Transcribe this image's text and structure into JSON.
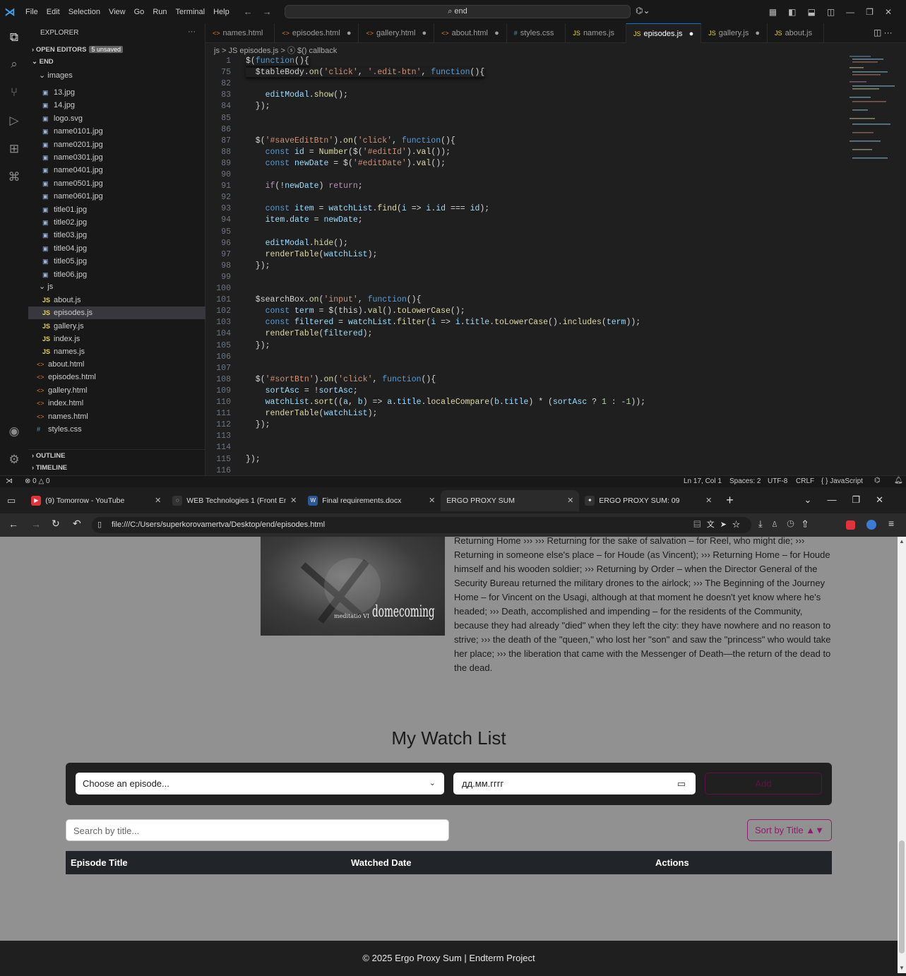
{
  "vscode": {
    "menu": [
      "File",
      "Edit",
      "Selection",
      "View",
      "Go",
      "Run",
      "Terminal",
      "Help"
    ],
    "command_center": "end",
    "explorer": {
      "title": "EXPLORER",
      "open_editors": "OPEN EDITORS",
      "unsaved": "5 unsaved",
      "root": "END",
      "images_folder": "images",
      "images": [
        "13.jpg",
        "14.jpg",
        "logo.svg",
        "name0101.jpg",
        "name0201.jpg",
        "name0301.jpg",
        "name0401.jpg",
        "name0501.jpg",
        "name0601.jpg",
        "title01.jpg",
        "title02.jpg",
        "title03.jpg",
        "title04.jpg",
        "title05.jpg",
        "title06.jpg"
      ],
      "js_folder": "js",
      "js_files": [
        "about.js",
        "episodes.js",
        "gallery.js",
        "index.js",
        "names.js"
      ],
      "root_files": [
        "about.html",
        "episodes.html",
        "gallery.html",
        "index.html",
        "names.html",
        "styles.css"
      ],
      "outline": "OUTLINE",
      "timeline": "TIMELINE"
    },
    "tabs": [
      {
        "label": "names.html",
        "type": "html",
        "dirty": false
      },
      {
        "label": "episodes.html",
        "type": "html",
        "dirty": true
      },
      {
        "label": "gallery.html",
        "type": "html",
        "dirty": true
      },
      {
        "label": "about.html",
        "type": "html",
        "dirty": true
      },
      {
        "label": "styles.css",
        "type": "css",
        "dirty": false
      },
      {
        "label": "names.js",
        "type": "js",
        "dirty": false
      },
      {
        "label": "episodes.js",
        "type": "js",
        "dirty": true,
        "active": true
      },
      {
        "label": "gallery.js",
        "type": "js",
        "dirty": true
      },
      {
        "label": "about.js",
        "type": "js",
        "dirty": false
      }
    ],
    "breadcrumb": "js > JS episodes.js > ⓢ $() callback",
    "code": [
      {
        "ln": "1",
        "code": "$(function(){"
      },
      {
        "ln": "75",
        "code": "  $tableBody.on('click', '.edit-btn', function(){"
      },
      {
        "ln": "82",
        "code": ""
      },
      {
        "ln": "83",
        "code": "    editModal.show();"
      },
      {
        "ln": "84",
        "code": "  });"
      },
      {
        "ln": "85",
        "code": ""
      },
      {
        "ln": "86",
        "code": ""
      },
      {
        "ln": "87",
        "code": "  $('#saveEditBtn').on('click', function(){"
      },
      {
        "ln": "88",
        "code": "    const id = Number($('#editId').val());"
      },
      {
        "ln": "89",
        "code": "    const newDate = $('#editDate').val();"
      },
      {
        "ln": "90",
        "code": ""
      },
      {
        "ln": "91",
        "code": "    if(!newDate) return;"
      },
      {
        "ln": "92",
        "code": ""
      },
      {
        "ln": "93",
        "code": "    const item = watchList.find(i => i.id === id);"
      },
      {
        "ln": "94",
        "code": "    item.date = newDate;"
      },
      {
        "ln": "95",
        "code": ""
      },
      {
        "ln": "96",
        "code": "    editModal.hide();"
      },
      {
        "ln": "97",
        "code": "    renderTable(watchList);"
      },
      {
        "ln": "98",
        "code": "  });"
      },
      {
        "ln": "99",
        "code": ""
      },
      {
        "ln": "100",
        "code": ""
      },
      {
        "ln": "101",
        "code": "  $searchBox.on('input', function(){"
      },
      {
        "ln": "102",
        "code": "    const term = $(this).val().toLowerCase();"
      },
      {
        "ln": "103",
        "code": "    const filtered = watchList.filter(i => i.title.toLowerCase().includes(term));"
      },
      {
        "ln": "104",
        "code": "    renderTable(filtered);"
      },
      {
        "ln": "105",
        "code": "  });"
      },
      {
        "ln": "106",
        "code": ""
      },
      {
        "ln": "107",
        "code": ""
      },
      {
        "ln": "108",
        "code": "  $('#sortBtn').on('click', function(){"
      },
      {
        "ln": "109",
        "code": "    sortAsc = !sortAsc;"
      },
      {
        "ln": "110",
        "code": "    watchList.sort((a, b) => a.title.localeCompare(b.title) * (sortAsc ? 1 : -1));"
      },
      {
        "ln": "111",
        "code": "    renderTable(watchList);"
      },
      {
        "ln": "112",
        "code": "  });"
      },
      {
        "ln": "113",
        "code": ""
      },
      {
        "ln": "114",
        "code": ""
      },
      {
        "ln": "115",
        "code": "});"
      },
      {
        "ln": "116",
        "code": ""
      }
    ],
    "status": {
      "problems": "⊗ 0 △ 0",
      "position": "Ln 17, Col 1",
      "spaces": "Spaces: 2",
      "encoding": "UTF-8",
      "eol": "CRLF",
      "language": "{ } JavaScript"
    }
  },
  "browser": {
    "tabs": [
      {
        "label": "(9) Tomorrow - YouTube",
        "fav": "yt"
      },
      {
        "label": "WEB Technologies 1 (Front End) |",
        "fav": "web"
      },
      {
        "label": "Final requirements.docx",
        "fav": "word"
      },
      {
        "label": "ERGO PROXY SUM",
        "fav": "none",
        "active": true
      },
      {
        "label": "ERGO PROXY SUM: 09",
        "fav": "ep"
      }
    ],
    "url": "file:///C:/Users/superkorovamertva/Desktop/end/episodes.html"
  },
  "page": {
    "poster_caption": "meditatio VI",
    "poster_word": "domecoming",
    "description": "Returning Home ››› ››› Returning for the sake of salvation – for Reel, who might die; ››› Returning in someone else's place – for Houde (as Vincent); ››› Returning Home – for Houde himself and his wooden soldier; ››› Returning by Order – when the Director General of the Security Bureau returned the military drones to the airlock; ››› The Beginning of the Journey Home – for Vincent on the Usagi, although at that moment he doesn't yet know where he's headed; ››› Death, accomplished and impending – for the residents of the Community, because they had already \"died\" when they left the city: they have nowhere and no reason to strive; ››› the death of the \"queen,\" who lost her \"son\" and saw the \"princess\" who would take her place; ››› the liberation that came with the Messenger of Death—the return of the dead to the dead.",
    "watch_list_title": "My Watch List",
    "episode_placeholder": "Choose an episode...",
    "date_placeholder": "дд.мм.гггг",
    "add_label": "Add",
    "search_placeholder": "Search by title...",
    "sort_label": "Sort by Title ▲▼",
    "table_headers": [
      "Episode Title",
      "Watched Date",
      "Actions"
    ],
    "footer": "© 2025 Ergo Proxy Sum | Endterm Project"
  }
}
